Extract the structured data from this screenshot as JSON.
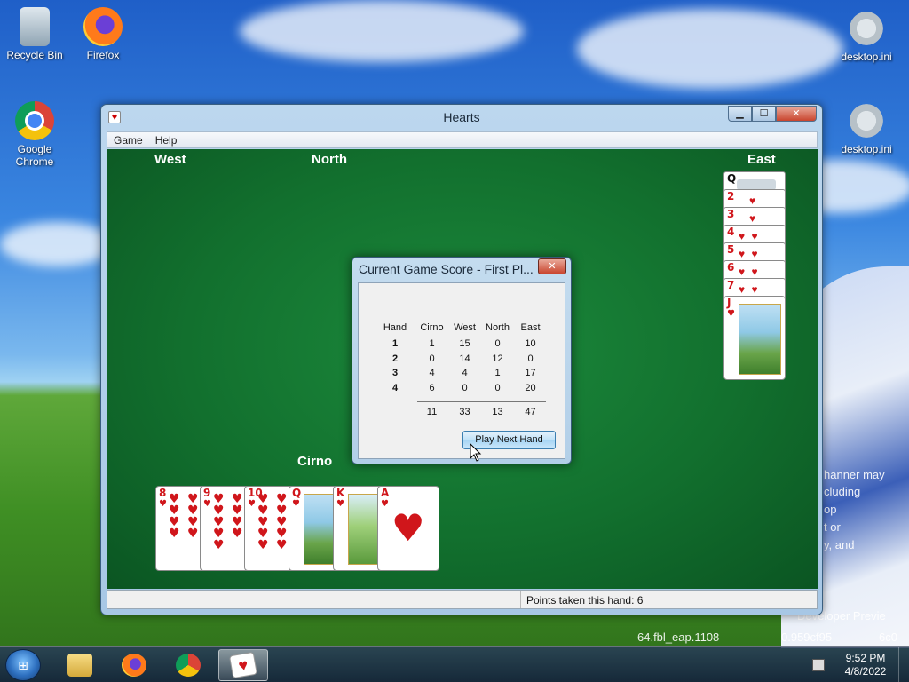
{
  "desktop": {
    "icons_left": [
      {
        "label": "Recycle Bin",
        "icon": "recycle-bin-icon"
      },
      {
        "label": "Firefox",
        "icon": "firefox-icon"
      },
      {
        "label": "Google Chrome",
        "icon": "chrome-icon"
      }
    ],
    "icons_right": [
      {
        "label": "desktop.ini",
        "icon": "settings-file-icon"
      },
      {
        "label": "desktop.ini",
        "icon": "settings-file-icon"
      }
    ],
    "wallpaper_text": [
      "hanner may",
      "cluding",
      "op",
      "t or",
      "y, and",
      "Developer Previe",
      "64.fbl_eap.1108",
      "0.959cf95",
      "6c0"
    ]
  },
  "window": {
    "title": "Hearts",
    "controls": {
      "minimize": "▁",
      "maximize": "☐",
      "close": "✕"
    },
    "menu": [
      "Game",
      "Help"
    ],
    "players": {
      "west": "West",
      "north": "North",
      "east": "East",
      "south": "Cirno"
    },
    "status": "Points taken this hand: 6"
  },
  "south_hand": [
    {
      "rank": "8",
      "suit": "♥",
      "type": "pips",
      "count": 8
    },
    {
      "rank": "9",
      "suit": "♥",
      "type": "pips",
      "count": 9
    },
    {
      "rank": "10",
      "suit": "♥",
      "type": "pips",
      "count": 10
    },
    {
      "rank": "Q",
      "suit": "♥",
      "type": "face"
    },
    {
      "rank": "K",
      "suit": "♥",
      "type": "face"
    },
    {
      "rank": "A",
      "suit": "♥",
      "type": "ace"
    }
  ],
  "east_taken": [
    {
      "rank": "Q",
      "suit": "♠"
    },
    {
      "rank": "2",
      "suit": "♥"
    },
    {
      "rank": "3",
      "suit": "♥"
    },
    {
      "rank": "4",
      "suit": "♥"
    },
    {
      "rank": "5",
      "suit": "♥"
    },
    {
      "rank": "6",
      "suit": "♥"
    },
    {
      "rank": "7",
      "suit": "♥"
    },
    {
      "rank": "J",
      "suit": "♥"
    }
  ],
  "dialog": {
    "title": "Current Game Score - First Pl...",
    "close": "✕",
    "headers": [
      "Hand",
      "Cirno",
      "West",
      "North",
      "East"
    ],
    "rows": [
      [
        "1",
        "1",
        "15",
        "0",
        "10"
      ],
      [
        "2",
        "0",
        "14",
        "12",
        "0"
      ],
      [
        "3",
        "4",
        "4",
        "1",
        "17"
      ],
      [
        "4",
        "6",
        "0",
        "0",
        "20"
      ]
    ],
    "totals": [
      "11",
      "33",
      "13",
      "47"
    ],
    "button": "Play Next Hand"
  },
  "taskbar": {
    "start": "⊞",
    "items": [
      {
        "icon": "file-explorer-icon",
        "active": false
      },
      {
        "icon": "firefox-icon",
        "active": false
      },
      {
        "icon": "chrome-icon",
        "active": false
      },
      {
        "icon": "hearts-icon",
        "active": true
      }
    ],
    "time": "9:52 PM",
    "date": "4/8/2022"
  }
}
